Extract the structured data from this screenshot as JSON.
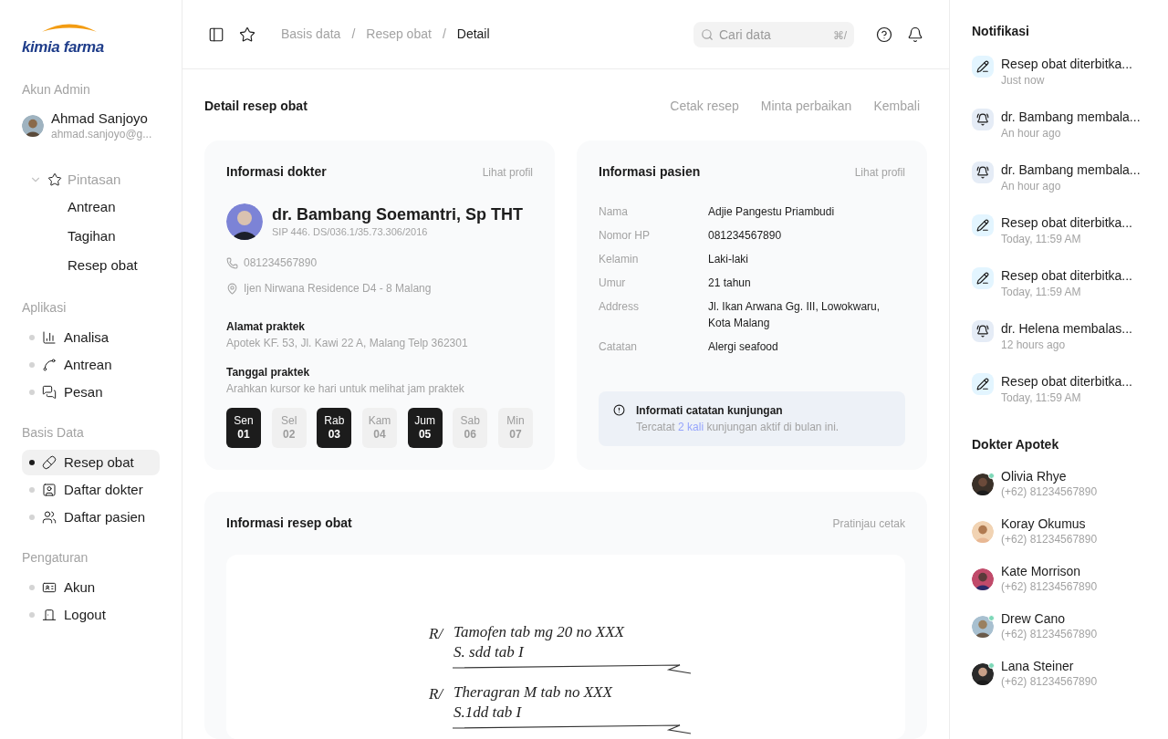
{
  "logo": {
    "text": "kimia farma"
  },
  "account": {
    "heading": "Akun Admin",
    "name": "Ahmad Sanjoyo",
    "email": "ahmad.sanjoyo@g..."
  },
  "shortcuts": {
    "label": "Pintasan",
    "expanded": true,
    "children": [
      {
        "label": "Antrean",
        "selected": false
      },
      {
        "label": "Tagihan",
        "selected": false
      },
      {
        "label": "Resep obat",
        "selected": false
      }
    ]
  },
  "sidebar_sections": [
    {
      "heading": "Aplikasi",
      "items": [
        {
          "label": "Analisa",
          "selected": false
        },
        {
          "label": "Antrean",
          "selected": false
        },
        {
          "label": "Pesan",
          "selected": false
        }
      ]
    },
    {
      "heading": "Basis Data",
      "items": [
        {
          "label": "Resep obat",
          "selected": true
        },
        {
          "label": "Daftar dokter",
          "selected": false
        },
        {
          "label": "Daftar pasien",
          "selected": false
        }
      ]
    },
    {
      "heading": "Pengaturan",
      "items": [
        {
          "label": "Akun",
          "selected": false
        },
        {
          "label": "Logout",
          "selected": false
        }
      ]
    }
  ],
  "breadcrumbs": [
    "Basis data",
    "Resep obat",
    "Detail"
  ],
  "breadcrumb_separator": "/",
  "search": {
    "placeholder": "Cari data",
    "shortcut": "⌘/"
  },
  "page": {
    "title": "Detail resep obat",
    "actions": [
      "Cetak resep",
      "Minta perbaikan",
      "Kembali"
    ]
  },
  "doctor_card": {
    "title": "Informasi dokter",
    "link": "Lihat profil",
    "name": "dr. Bambang Soemantri, Sp THT",
    "license": "SIP 446. DS/036.1/35.73.306/2016",
    "phone": "081234567890",
    "address": "Ijen Nirwana Residence D4 - 8 Malang",
    "practice_address_label": "Alamat praktek",
    "practice_address": "Apotek KF. 53, Jl. Kawi 22 A, Malang Telp 362301",
    "practice_days_label": "Tanggal praktek",
    "practice_days_hint": "Arahkan kursor ke hari untuk melihat jam praktek",
    "days": [
      {
        "day": "Sen",
        "date": "01",
        "active": true
      },
      {
        "day": "Sel",
        "date": "02",
        "active": false
      },
      {
        "day": "Rab",
        "date": "03",
        "active": true
      },
      {
        "day": "Kam",
        "date": "04",
        "active": false
      },
      {
        "day": "Jum",
        "date": "05",
        "active": true
      },
      {
        "day": "Sab",
        "date": "06",
        "active": false
      },
      {
        "day": "Min",
        "date": "07",
        "active": false
      }
    ]
  },
  "patient_card": {
    "title": "Informasi pasien",
    "link": "Lihat profil",
    "fields": [
      {
        "label": "Nama",
        "value": "Adjie Pangestu Priambudi"
      },
      {
        "label": "Nomor HP",
        "value": "081234567890"
      },
      {
        "label": "Kelamin",
        "value": "Laki-laki"
      },
      {
        "label": "Umur",
        "value": "21 tahun"
      },
      {
        "label": "Address",
        "value": "Jl. Ikan Arwana Gg. III, Lowokwaru, Kota Malang"
      },
      {
        "label": "Catatan",
        "value": "Alergi seafood"
      }
    ],
    "notice": {
      "title": "Informati catatan kunjungan",
      "before": "Tercatat ",
      "link": "2 kali",
      "after": " kunjungan aktif di bulan ini."
    }
  },
  "prescription_card": {
    "title": "Informasi resep obat",
    "link": "Pratinjau cetak",
    "entries": [
      {
        "symbol": "R/",
        "lines": [
          "Tamofen tab mg 20 no XXX",
          "S. sdd tab I"
        ]
      },
      {
        "symbol": "R/",
        "lines": [
          "Theragran M tab no XXX",
          "S.1dd tab I"
        ]
      }
    ]
  },
  "notifications": {
    "title": "Notifikasi",
    "items": [
      {
        "kind": "prescription",
        "text": "Resep obat diterbitka...",
        "time": "Just now"
      },
      {
        "kind": "reply",
        "text": "dr. Bambang membala...",
        "time": "An hour ago"
      },
      {
        "kind": "reply",
        "text": "dr. Bambang membala...",
        "time": "An hour ago"
      },
      {
        "kind": "prescription",
        "text": "Resep obat diterbitka...",
        "time": "Today, 11:59 AM"
      },
      {
        "kind": "prescription",
        "text": "Resep obat diterbitka...",
        "time": "Today, 11:59 AM"
      },
      {
        "kind": "reply",
        "text": "dr. Helena membalas...",
        "time": "12 hours ago"
      },
      {
        "kind": "prescription",
        "text": "Resep obat diterbitka...",
        "time": "Today, 11:59 AM"
      }
    ]
  },
  "pharmacy_doctors": {
    "title": "Dokter Apotek",
    "items": [
      {
        "name": "Olivia Rhye",
        "phone": "(+62) 81234567890",
        "online": true
      },
      {
        "name": "Koray Okumus",
        "phone": "(+62) 81234567890",
        "online": false
      },
      {
        "name": "Kate Morrison",
        "phone": "(+62) 81234567890",
        "online": false
      },
      {
        "name": "Drew Cano",
        "phone": "(+62) 81234567890",
        "online": true
      },
      {
        "name": "Lana Steiner",
        "phone": "(+62) 81234567890",
        "online": true
      }
    ]
  }
}
